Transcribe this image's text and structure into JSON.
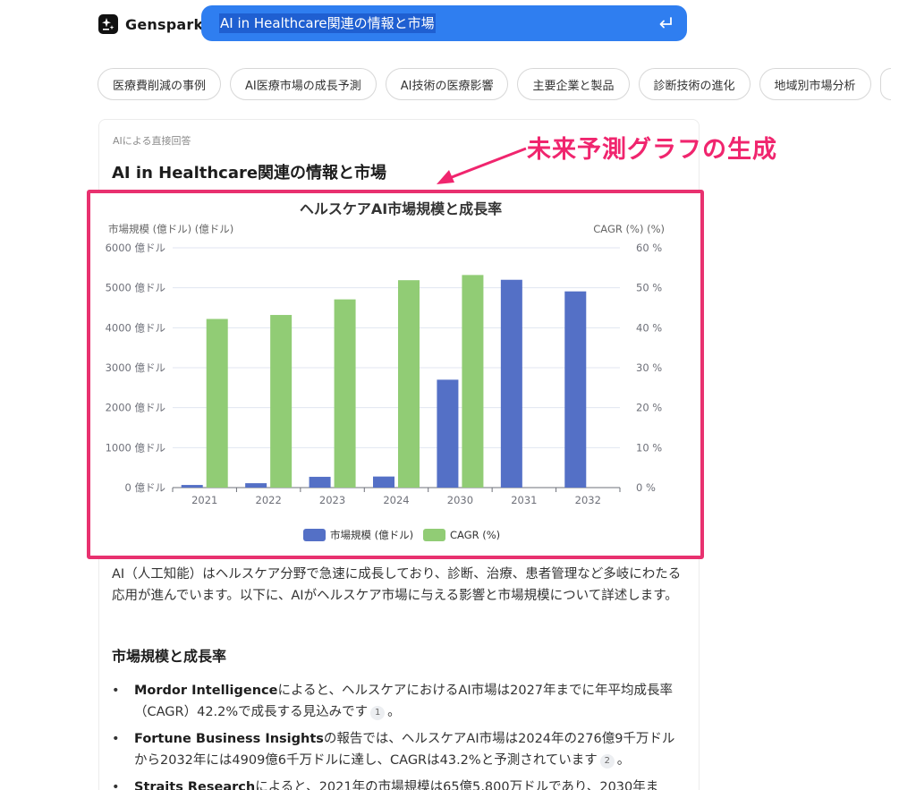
{
  "header": {
    "brand": "Genspark",
    "logo_icon": "sparkle-icon",
    "search_query": "AI in Healthcare関連の情報と市場",
    "enter_icon": "enter-icon"
  },
  "chips": [
    "医療費削減の事例",
    "AI医療市場の成長予測",
    "AI技術の医療影響",
    "主要企業と製品",
    "診断技術の進化",
    "地域別市場分析"
  ],
  "answer": {
    "label": "AIによる直接回答",
    "title": "AI in Healthcare関連の情報と市場"
  },
  "annotation": {
    "text": "未来予測グラフの生成",
    "color": "#f0256e"
  },
  "chart_data": {
    "type": "bar",
    "title": "ヘルスケアAI市場規模と成長率",
    "categories": [
      "2021",
      "2022",
      "2023",
      "2024",
      "2030",
      "2031",
      "2032"
    ],
    "left_axis": {
      "label": "市場規模 (億ドル) (億ドル)",
      "shown_label": "市場規模 (億ドル) (億ドル)",
      "ticks": [
        "0 億ドル",
        "1000 億ドル",
        "2000 億ドル",
        "3000 億ドル",
        "4000 億ドル",
        "5000 億ドル",
        "6000 億ドル"
      ],
      "ylim": [
        0,
        6000
      ]
    },
    "right_axis": {
      "label": "CAGR (%) (%)",
      "ticks": [
        "0 %",
        "10 %",
        "20 %",
        "30 %",
        "40 %",
        "50 %",
        "60 %"
      ],
      "ylim": [
        0,
        60
      ]
    },
    "series": [
      {
        "name": "市場規模 (億ドル)",
        "axis": "left",
        "color": "#5470c6",
        "values": [
          65.8,
          110,
          270,
          277,
          2700,
          5200,
          4910
        ]
      },
      {
        "name": "CAGR (%)",
        "axis": "right",
        "color": "#91cc75",
        "values": [
          42.2,
          43.2,
          47.1,
          51.9,
          53.2,
          null,
          null
        ]
      }
    ],
    "legend_position": "bottom-center",
    "grid": true
  },
  "body": {
    "paragraph": "AI（人工知能）はヘルスケア分野で急速に成長しており、診断、治療、患者管理など多岐にわたる応用が進んでいます。以下に、AIがヘルスケア市場に与える影響と市場規模について詳述します。",
    "section_title": "市場規模と成長率",
    "bullets": [
      {
        "bold": "Mordor Intelligence",
        "text": "によると、ヘルスケアにおけるAI市場は2027年までに年平均成長率（CAGR）42.2%で成長する見込みです",
        "cite": "1",
        "tail": "。"
      },
      {
        "bold": "Fortune Business Insights",
        "text": "の報告では、ヘルスケアAI市場は2024年の276億9千万ドルから2032年には4909億6千万ドルに達し、CAGRは43.2%と予測されています",
        "cite": "2",
        "tail": "。"
      },
      {
        "bold": "Straits Research",
        "text": "によると、2021年の市場規模は65億5,800万ドルであり、2030年ま",
        "cite": "",
        "tail": ""
      }
    ]
  }
}
